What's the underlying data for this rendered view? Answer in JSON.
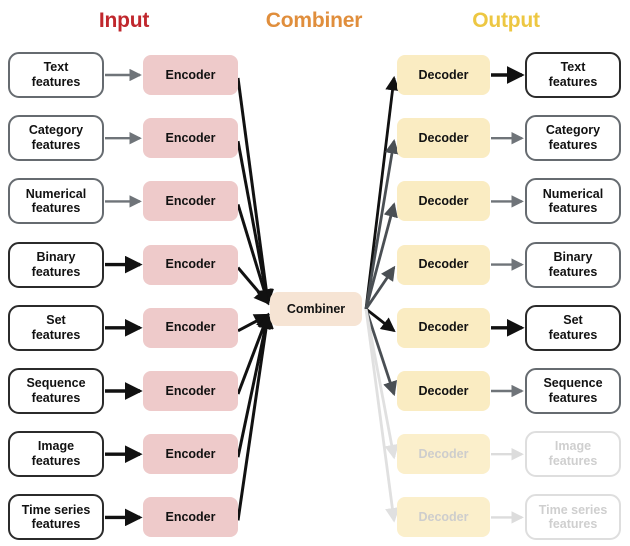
{
  "headers": {
    "input": "Input",
    "combiner": "Combiner",
    "output": "Output"
  },
  "colors": {
    "input_header": "#c0272d",
    "combiner_header": "#e08e3c",
    "output_header": "#edc742",
    "encoder_fill": "#eecaca",
    "decoder_fill": "#faecc2",
    "combiner_fill": "#f6e4d4",
    "box_border_dark": "#2b2b2b",
    "box_border_gray": "#666b70",
    "faded": "#dedede"
  },
  "combiner": {
    "label": "Combiner"
  },
  "encoder_label": "Encoder",
  "decoder_label": "Decoder",
  "rows": [
    {
      "input_label": "Text\nfeatures",
      "input_line1": "Text",
      "input_line2": "features",
      "output_line1": "Text",
      "output_line2": "features",
      "encoder": "Encoder",
      "decoder": "Decoder",
      "input_style": "gray",
      "output_style": "dark",
      "in_arrow": "#6f7479",
      "out_arrow": "#111111",
      "comb_in_arrow": "#111111",
      "comb_out_arrow": "#111111"
    },
    {
      "input_line1": "Category",
      "input_line2": "features",
      "output_line1": "Category",
      "output_line2": "features",
      "encoder": "Encoder",
      "decoder": "Decoder",
      "input_style": "gray",
      "output_style": "gray",
      "in_arrow": "#6f7479",
      "out_arrow": "#6f7479",
      "comb_in_arrow": "#111111",
      "comb_out_arrow": "#4a4f54"
    },
    {
      "input_line1": "Numerical",
      "input_line2": "features",
      "output_line1": "Numerical",
      "output_line2": "features",
      "encoder": "Encoder",
      "decoder": "Decoder",
      "input_style": "gray",
      "output_style": "gray",
      "in_arrow": "#6f7479",
      "out_arrow": "#6f7479",
      "comb_in_arrow": "#111111",
      "comb_out_arrow": "#4a4f54"
    },
    {
      "input_line1": "Binary",
      "input_line2": "features",
      "output_line1": "Binary",
      "output_line2": "features",
      "encoder": "Encoder",
      "decoder": "Decoder",
      "input_style": "dark",
      "output_style": "gray",
      "in_arrow": "#111111",
      "out_arrow": "#6f7479",
      "comb_in_arrow": "#111111",
      "comb_out_arrow": "#4a4f54"
    },
    {
      "input_line1": "Set",
      "input_line2": "features",
      "output_line1": "Set",
      "output_line2": "features",
      "encoder": "Encoder",
      "decoder": "Decoder",
      "input_style": "dark",
      "output_style": "dark",
      "in_arrow": "#111111",
      "out_arrow": "#111111",
      "comb_in_arrow": "#111111",
      "comb_out_arrow": "#111111"
    },
    {
      "input_line1": "Sequence",
      "input_line2": "features",
      "output_line1": "Sequence",
      "output_line2": "features",
      "encoder": "Encoder",
      "decoder": "Decoder",
      "input_style": "dark",
      "output_style": "gray",
      "in_arrow": "#111111",
      "out_arrow": "#6f7479",
      "comb_in_arrow": "#111111",
      "comb_out_arrow": "#4a4f54"
    },
    {
      "input_line1": "Image",
      "input_line2": "features",
      "output_line1": "Image",
      "output_line2": "features",
      "encoder": "Encoder",
      "decoder": "Decoder",
      "input_style": "dark",
      "output_style": "faded",
      "in_arrow": "#111111",
      "out_arrow": "#dcdcdc",
      "comb_in_arrow": "#111111",
      "comb_out_arrow": "#e0e0e0"
    },
    {
      "input_line1": "Time series",
      "input_line2": "features",
      "output_line1": "Time series",
      "output_line2": "features",
      "encoder": "Encoder",
      "decoder": "Decoder",
      "input_style": "dark",
      "output_style": "faded",
      "in_arrow": "#111111",
      "out_arrow": "#dcdcdc",
      "comb_in_arrow": "#111111",
      "comb_out_arrow": "#e0e0e0"
    }
  ]
}
